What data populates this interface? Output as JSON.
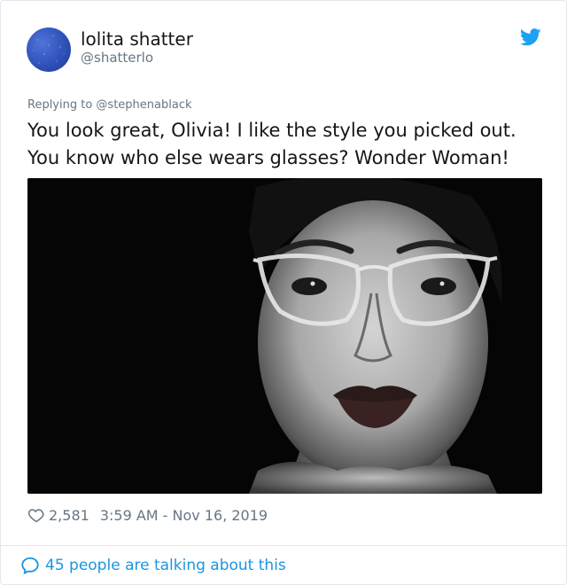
{
  "author": {
    "display_name": "lolita shatter",
    "handle": "@shatterlo"
  },
  "reply": {
    "replying_to": "Replying to @stephenablack"
  },
  "tweet": {
    "text": "You look great, Olivia! I like the style you picked out. You know who else wears glasses? Wonder Woman!"
  },
  "media": {
    "description_icon": "photo-woman-glasses-blowing-kiss"
  },
  "stats": {
    "likes": "2,581",
    "timestamp": "3:59 AM - Nov 16, 2019"
  },
  "footer": {
    "talking_label": "45 people are talking about this"
  },
  "colors": {
    "accent": "#1b95e0",
    "muted": "#657786",
    "text": "#14171a",
    "border": "#e1e8ed"
  },
  "icons": {
    "platform": "twitter-bird-icon",
    "like": "heart-outline-icon",
    "talk": "speech-bubble-icon"
  }
}
